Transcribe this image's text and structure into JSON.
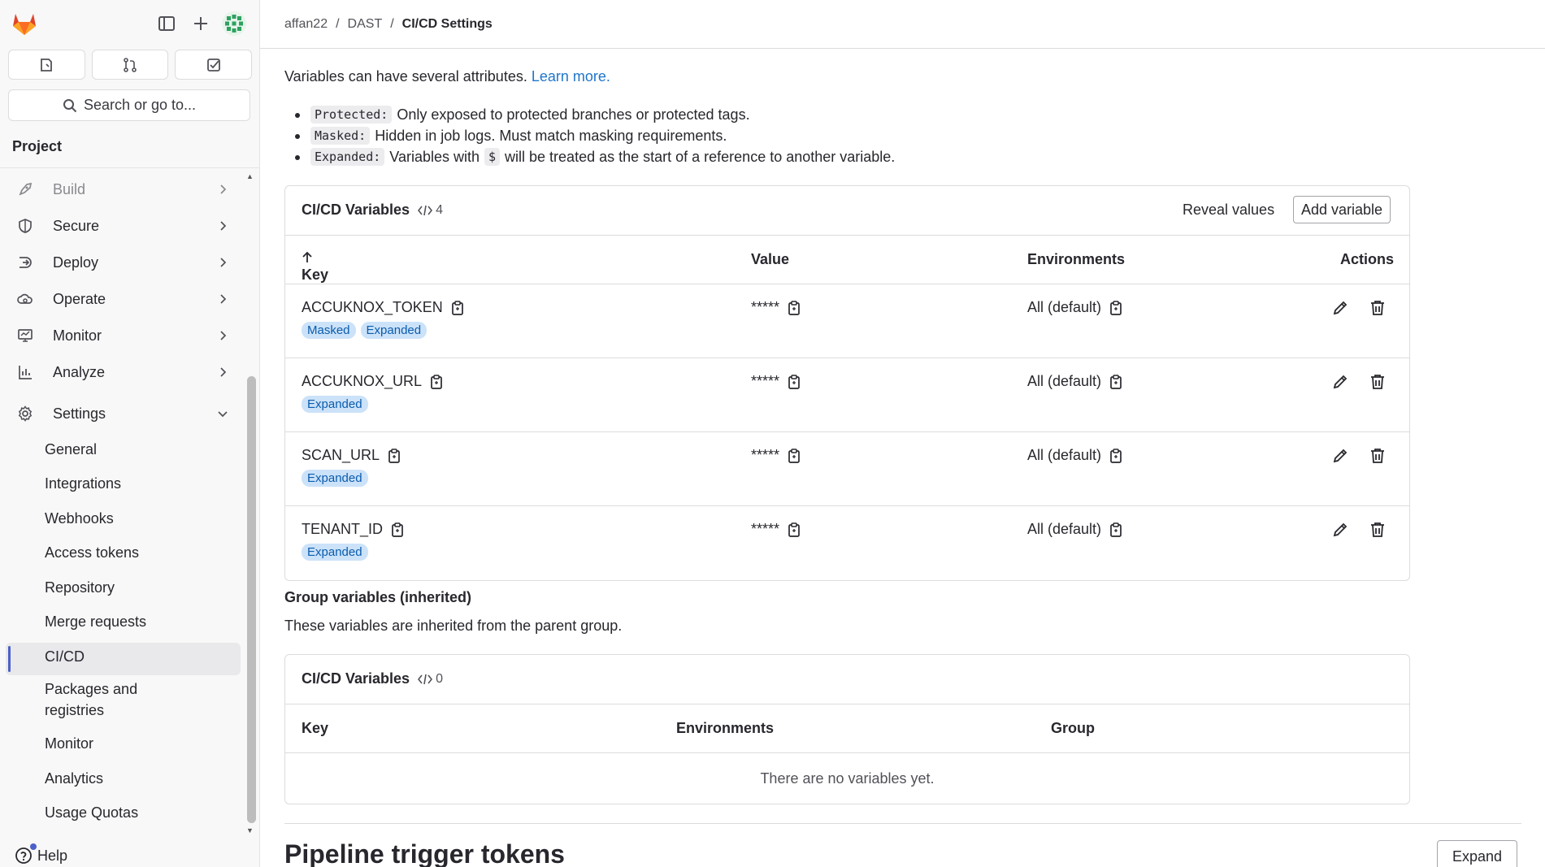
{
  "breadcrumb": {
    "items": [
      "affan22",
      "DAST"
    ],
    "current": "CI/CD Settings",
    "separator": "/"
  },
  "sidebar": {
    "search_label": "Search or go to...",
    "section_title": "Project",
    "nav": [
      {
        "label": "Build",
        "icon": "rocket-icon"
      },
      {
        "label": "Secure",
        "icon": "shield-icon"
      },
      {
        "label": "Deploy",
        "icon": "deploy-icon"
      },
      {
        "label": "Operate",
        "icon": "cloud-gear-icon"
      },
      {
        "label": "Monitor",
        "icon": "monitor-icon"
      },
      {
        "label": "Analyze",
        "icon": "chart-icon"
      },
      {
        "label": "Settings",
        "icon": "gear-icon"
      }
    ],
    "settings_sub": [
      "General",
      "Integrations",
      "Webhooks",
      "Access tokens",
      "Repository",
      "Merge requests",
      "CI/CD",
      "Packages and",
      "registries",
      "Monitor",
      "Analytics",
      "Usage Quotas"
    ],
    "active_sub": "CI/CD",
    "help_label": "Help"
  },
  "intro": {
    "text": "Variables can have several attributes.",
    "link": "Learn more.",
    "bullets": [
      {
        "code": "Protected:",
        "text": "Only exposed to protected branches or protected tags."
      },
      {
        "code": "Masked:",
        "text": "Hidden in job logs. Must match masking requirements."
      },
      {
        "code": "Expanded:",
        "text": "Variables with",
        "code2": "$",
        "text2": "will be treated as the start of a reference to another variable."
      }
    ]
  },
  "variables_card": {
    "title": "CI/CD Variables",
    "count": "4",
    "reveal_label": "Reveal values",
    "add_label": "Add variable",
    "headers": {
      "key": "Key",
      "value": "Value",
      "environments": "Environments",
      "actions": "Actions"
    },
    "rows": [
      {
        "key": "ACCUKNOX_TOKEN",
        "value": "*****",
        "env": "All (default)",
        "badges": [
          "Masked",
          "Expanded"
        ]
      },
      {
        "key": "ACCUKNOX_URL",
        "value": "*****",
        "env": "All (default)",
        "badges": [
          "Expanded"
        ]
      },
      {
        "key": "SCAN_URL",
        "value": "*****",
        "env": "All (default)",
        "badges": [
          "Expanded"
        ]
      },
      {
        "key": "TENANT_ID",
        "value": "*****",
        "env": "All (default)",
        "badges": [
          "Expanded"
        ]
      }
    ]
  },
  "group_vars": {
    "title": "Group variables (inherited)",
    "desc": "These variables are inherited from the parent group.",
    "card_title": "CI/CD Variables",
    "count": "0",
    "headers": {
      "key": "Key",
      "environments": "Environments",
      "group": "Group"
    },
    "empty": "There are no variables yet."
  },
  "pipeline": {
    "title": "Pipeline trigger tokens",
    "expand_label": "Expand"
  },
  "colors": {
    "accent": "#4b60c8",
    "link": "#1f75cb",
    "badge_bg": "#cbe2f9",
    "badge_fg": "#0b5cad"
  }
}
